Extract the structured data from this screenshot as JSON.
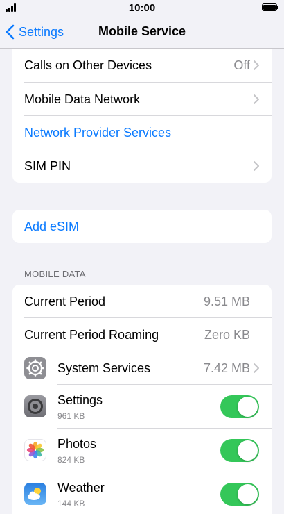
{
  "status": {
    "time": "10:00"
  },
  "nav": {
    "back_label": "Settings",
    "title": "Mobile Service"
  },
  "group1": {
    "rows": [
      {
        "label": "Calls on Other Devices",
        "value": "Off"
      },
      {
        "label": "Mobile Data Network"
      },
      {
        "label": "Network Provider Services"
      },
      {
        "label": "SIM PIN"
      }
    ]
  },
  "esim": {
    "label": "Add eSIM"
  },
  "mobile_data": {
    "header": "MOBILE DATA",
    "current_period": {
      "label": "Current Period",
      "value": "9.51 MB"
    },
    "current_period_roaming": {
      "label": "Current Period Roaming",
      "value": "Zero KB"
    },
    "system_services": {
      "label": "System Services",
      "value": "7.42 MB",
      "icon": "gear-icon"
    },
    "apps": [
      {
        "name": "Settings",
        "usage": "961 KB",
        "enabled": true,
        "icon": "settings-app-icon"
      },
      {
        "name": "Photos",
        "usage": "824 KB",
        "enabled": true,
        "icon": "photos-app-icon"
      },
      {
        "name": "Weather",
        "usage": "144 KB",
        "enabled": true,
        "icon": "weather-app-icon"
      }
    ]
  },
  "colors": {
    "accent": "#0a7aff",
    "toggle_on": "#34c759",
    "background": "#f2f2f7"
  }
}
